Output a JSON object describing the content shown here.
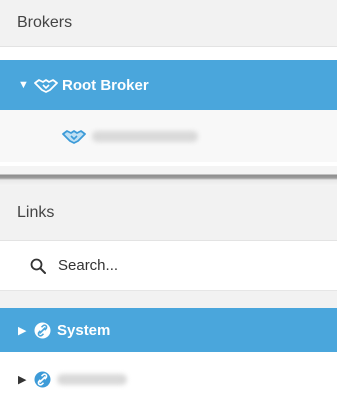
{
  "brokers": {
    "header": "Brokers",
    "root": {
      "label": "Root Broker",
      "expanded": true,
      "icon": "handshake-icon"
    },
    "child": {
      "label": "",
      "icon": "handshake-icon"
    }
  },
  "links": {
    "header": "Links",
    "search": {
      "placeholder": "Search...",
      "value": ""
    },
    "items": [
      {
        "label": "System",
        "selected": true,
        "icon": "link-icon"
      },
      {
        "label": "",
        "selected": false,
        "icon": "link-icon"
      }
    ]
  },
  "colors": {
    "selected_bg": "#4aa6dc",
    "header_bg": "#f2f2f2",
    "icon_blue": "#3d9bd8"
  }
}
